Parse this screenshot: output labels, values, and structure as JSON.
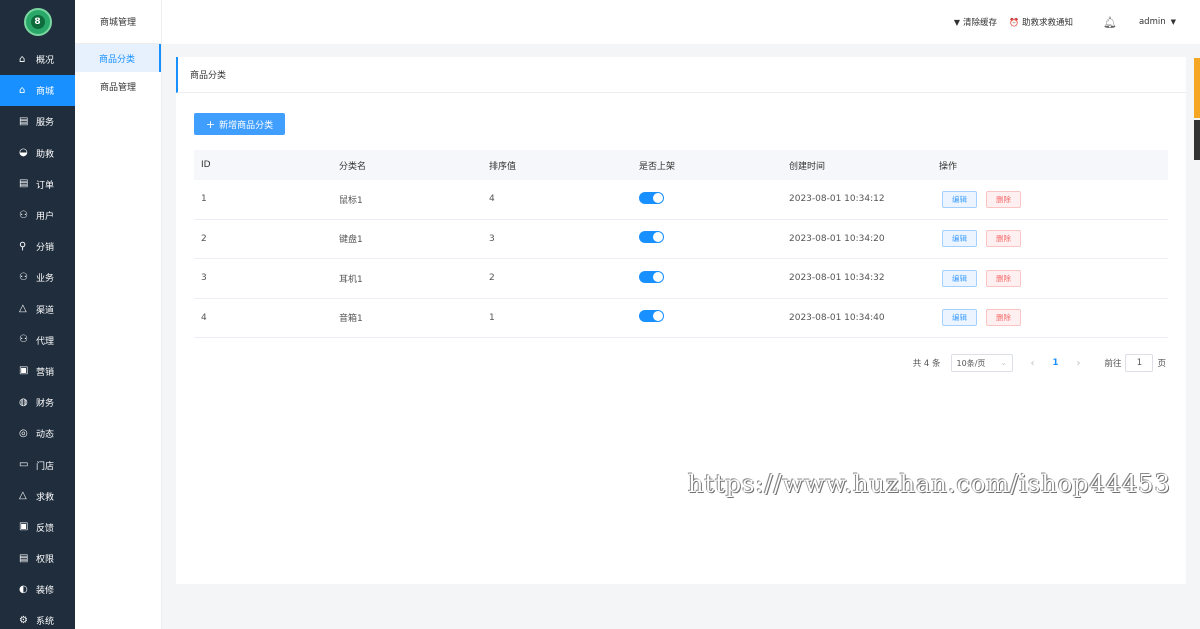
{
  "logo": {
    "text": "8"
  },
  "sidebar": {
    "items": [
      {
        "label": "概况",
        "icon": "home-icon",
        "active": false
      },
      {
        "label": "商城",
        "icon": "shop-icon",
        "active": true
      },
      {
        "label": "服务",
        "icon": "service-icon",
        "active": false
      },
      {
        "label": "助救",
        "icon": "rescue-icon",
        "active": false
      },
      {
        "label": "订单",
        "icon": "order-icon",
        "active": false
      },
      {
        "label": "用户",
        "icon": "user-icon",
        "active": false
      },
      {
        "label": "分销",
        "icon": "distribution-icon",
        "active": false
      },
      {
        "label": "业务",
        "icon": "business-icon",
        "active": false
      },
      {
        "label": "渠道",
        "icon": "channel-icon",
        "active": false
      },
      {
        "label": "代理",
        "icon": "agent-icon",
        "active": false
      },
      {
        "label": "营销",
        "icon": "marketing-icon",
        "active": false
      },
      {
        "label": "财务",
        "icon": "finance-icon",
        "active": false
      },
      {
        "label": "动态",
        "icon": "compass-icon",
        "active": false
      },
      {
        "label": "门店",
        "icon": "store-icon",
        "active": false
      },
      {
        "label": "求救",
        "icon": "bell-icon",
        "active": false
      },
      {
        "label": "反馈",
        "icon": "feedback-icon",
        "active": false
      },
      {
        "label": "权限",
        "icon": "permission-icon",
        "active": false
      },
      {
        "label": "装修",
        "icon": "decorate-icon",
        "active": false
      },
      {
        "label": "系统",
        "icon": "settings-icon",
        "active": false
      }
    ]
  },
  "subnav": {
    "title": "商城管理",
    "items": [
      {
        "label": "商品分类",
        "active": true
      },
      {
        "label": "商品管理",
        "active": false
      }
    ]
  },
  "topbar": {
    "clear_cache": "清除缓存",
    "rescue_notice": "助救求救通知",
    "user": "admin"
  },
  "card": {
    "title": "商品分类",
    "add_button": "新增商品分类"
  },
  "table": {
    "headers": [
      "ID",
      "分类名",
      "排序值",
      "是否上架",
      "创建时间",
      "操作"
    ],
    "rows": [
      {
        "id": "1",
        "name": "鼠标1",
        "sort": "4",
        "on_shelf": true,
        "created": "2023-08-01 10:34:12"
      },
      {
        "id": "2",
        "name": "键盘1",
        "sort": "3",
        "on_shelf": true,
        "created": "2023-08-01 10:34:20"
      },
      {
        "id": "3",
        "name": "耳机1",
        "sort": "2",
        "on_shelf": true,
        "created": "2023-08-01 10:34:32"
      },
      {
        "id": "4",
        "name": "音箱1",
        "sort": "1",
        "on_shelf": true,
        "created": "2023-08-01 10:34:40"
      }
    ],
    "edit_label": "编辑",
    "delete_label": "删除"
  },
  "pagination": {
    "total": "共 4 条",
    "page_size": "10条/页",
    "current_page": "1",
    "goto_label": "前往",
    "goto_value": "1",
    "goto_unit": "页"
  },
  "watermark": "https://www.huzhan.com/ishop44453",
  "colors": {
    "sidebar_bg": "#1f2d3d",
    "accent": "#1890ff",
    "logo": "#2aa86a"
  }
}
